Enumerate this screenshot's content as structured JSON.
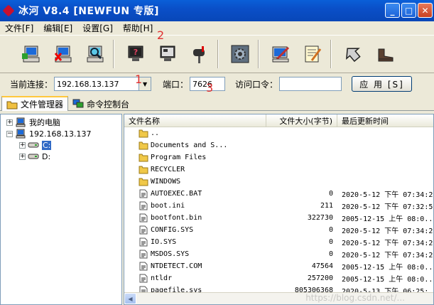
{
  "window": {
    "title": "冰河 V8.4 [NEWFUN 专版]"
  },
  "menu": [
    "文件[F]",
    "编辑[E]",
    "设置[G]",
    "帮助[H]"
  ],
  "toolbar": {
    "icons": [
      "add-computer-icon",
      "remove-computer-icon",
      "search-computer-icon",
      "help-monitor-icon",
      "screen-monitor-icon",
      "mailbox-icon",
      "gear-settings-icon",
      "edit-pen-icon",
      "tools-icon",
      "arrow-back-icon",
      "boots-exit-icon"
    ]
  },
  "connection": {
    "current_label": "当前连接：",
    "current_value": "192.168.13.137",
    "port_label": "端口：",
    "port_value": "7626",
    "password_label": "访问口令：",
    "password_value": "",
    "apply_label": "应 用 [S]"
  },
  "annotations": {
    "m1": "1",
    "m2": "2",
    "m3": "3"
  },
  "tabs": [
    {
      "label": "文件管理器",
      "active": true
    },
    {
      "label": "命令控制台",
      "active": false
    }
  ],
  "tree": {
    "root": "我的电脑",
    "host": "192.168.13.137",
    "drives": [
      "C:",
      "D:"
    ]
  },
  "list": {
    "headers": {
      "name": "文件名称",
      "size": "文件大小(字节)",
      "date": "最后更新时间"
    },
    "rows": [
      {
        "name": "..",
        "size": "",
        "date": "",
        "type": "folder"
      },
      {
        "name": "Documents and S...",
        "size": "",
        "date": "",
        "type": "folder"
      },
      {
        "name": "Program Files",
        "size": "",
        "date": "",
        "type": "folder"
      },
      {
        "name": "RECYCLER",
        "size": "",
        "date": "",
        "type": "folder"
      },
      {
        "name": "WINDOWS",
        "size": "",
        "date": "",
        "type": "folder"
      },
      {
        "name": "AUTOEXEC.BAT",
        "size": "0",
        "date": "2020-5-12 下午 07:34:2",
        "type": "file"
      },
      {
        "name": "boot.ini",
        "size": "211",
        "date": "2020-5-12 下午 07:32:5",
        "type": "file"
      },
      {
        "name": "bootfont.bin",
        "size": "322730",
        "date": "2005-12-15 上午 08:0...",
        "type": "file"
      },
      {
        "name": "CONFIG.SYS",
        "size": "0",
        "date": "2020-5-12 下午 07:34:2",
        "type": "file"
      },
      {
        "name": "IO.SYS",
        "size": "0",
        "date": "2020-5-12 下午 07:34:2",
        "type": "file"
      },
      {
        "name": "MSDOS.SYS",
        "size": "0",
        "date": "2020-5-12 下午 07:34:2",
        "type": "file"
      },
      {
        "name": "NTDETECT.COM",
        "size": "47564",
        "date": "2005-12-15 上午 08:0...",
        "type": "file"
      },
      {
        "name": "ntldr",
        "size": "257200",
        "date": "2005-12-15 上午 08:0...",
        "type": "file"
      },
      {
        "name": "pagefile.sys",
        "size": "805306368",
        "date": "2020-5-13 下午 06:25:",
        "type": "file"
      }
    ]
  },
  "watermark": "https://blog.csdn.net/..."
}
